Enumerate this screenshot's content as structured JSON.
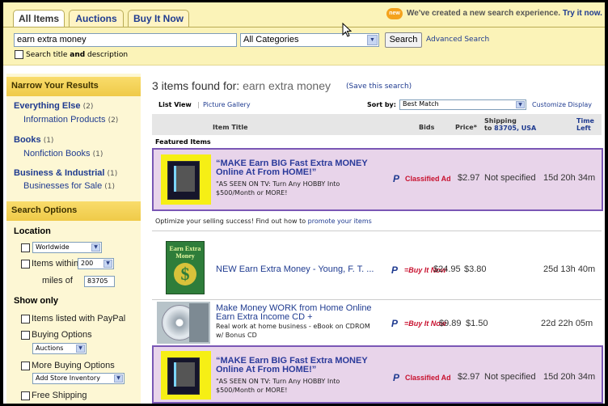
{
  "tabs": [
    "All Items",
    "Auctions",
    "Buy It Now"
  ],
  "notice": {
    "badge": "new",
    "text": "We've created a new search experience.",
    "link": "Try it now."
  },
  "search": {
    "query": "earn extra money",
    "category": "All Categories",
    "button": "Search",
    "advanced": "Advanced Search",
    "title_desc_pre": "Search title ",
    "title_desc_and": "and",
    "title_desc_post": " description"
  },
  "sidebar": {
    "narrow_header": "Narrow Your Results",
    "categories": [
      {
        "label": "Everything Else",
        "count": "(2)",
        "sub": "Information Products",
        "sub_count": "(2)"
      },
      {
        "label": "Books",
        "count": "(1)",
        "sub": "Nonfiction Books",
        "sub_count": "(1)"
      },
      {
        "label": "Business & Industrial",
        "count": "(1)",
        "sub": "Businesses for Sale",
        "sub_count": "(1)"
      }
    ],
    "options_header": "Search Options",
    "location_label": "Location",
    "location_select": "Worldwide",
    "items_within": "Items within",
    "distance": "200",
    "miles_of": "miles of",
    "zip": "83705",
    "show_only_label": "Show only",
    "paypal": "Items listed with PayPal",
    "buying_options": "Buying Options",
    "buying_select": "Auctions",
    "more_buying": "More Buying Options",
    "more_select": "Add Store Inventory",
    "free_shipping": "Free Shipping"
  },
  "results": {
    "count_text": "3 items found for:",
    "query": "earn extra money",
    "save": "(Save this search)",
    "list_view": "List View",
    "divider": "|",
    "gallery": "Picture Gallery",
    "sort_label": "Sort by:",
    "sort_value": "Best Match",
    "customize": "Customize Display",
    "col_title": "Item Title",
    "col_bids": "Bids",
    "col_price": "Price*",
    "col_ship1": "Shipping",
    "col_ship2_pre": "to",
    "col_ship2_zip": "83705, USA",
    "col_time1": "Time",
    "col_time2": "Left",
    "featured_label": "Featured Items",
    "optimize_text": "Optimize your selling success! Find out how to",
    "optimize_link": "promote your items"
  },
  "items": [
    {
      "title": "“MAKE Earn BIG Fast Extra MONEY Online At From HOME!”",
      "sub": "\"AS SEEN ON TV: Turn Any HOBBY Into $500/Month or MORE!",
      "bids": "Classified Ad",
      "price": "$2.97",
      "shipping": "Not specified",
      "time": "15d 20h 34m"
    },
    {
      "title": "NEW Earn Extra Money - Young, F. T. ...",
      "sub": "",
      "bids": "=Buy It Now",
      "price": "$24.95",
      "shipping": "$3.80",
      "time": "25d 13h 40m",
      "thumb_text": "Earn Extra Money"
    },
    {
      "title": "Make Money WORK from Home Online Earn Extra Income CD +",
      "sub": "Real work at home business - eBook on CDROM w/ Bonus CD",
      "bids": "=Buy It Now",
      "price": "$9.89",
      "shipping": "$1.50",
      "time": "22d 22h 05m"
    },
    {
      "title": "“MAKE Earn BIG Fast Extra MONEY Online At From HOME!”",
      "sub": "\"AS SEEN ON TV: Turn Any HOBBY Into $500/Month or MORE!",
      "bids": "Classified Ad",
      "price": "$2.97",
      "shipping": "Not specified",
      "time": "15d 20h 34m"
    }
  ],
  "colors": {
    "featured_bg": "#e8d4ea",
    "featured_border": "#7a57b5",
    "link": "#1f3b90",
    "sidebar_header": "#f9dc6b",
    "accent_red": "#c8102e"
  }
}
